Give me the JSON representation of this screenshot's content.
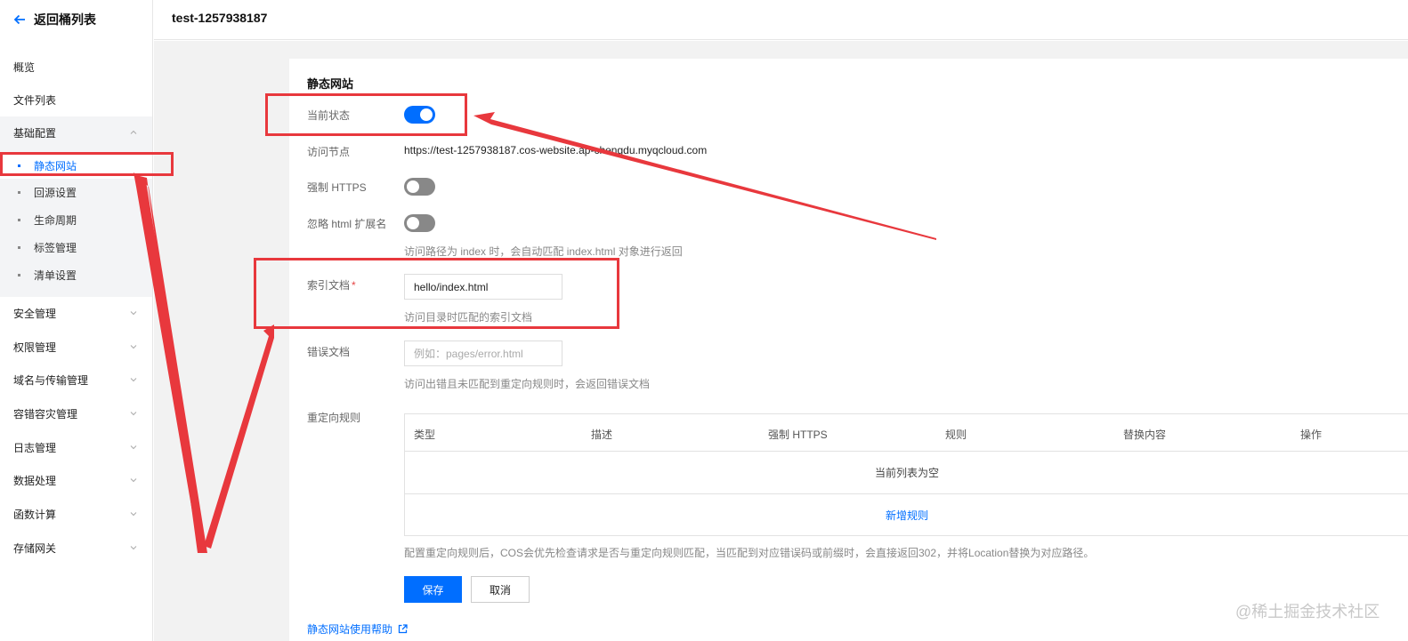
{
  "sidebar": {
    "back_label": "返回桶列表",
    "items_top": [
      "概览",
      "文件列表"
    ],
    "group": {
      "label": "基础配置",
      "children": [
        "静态网站",
        "回源设置",
        "生命周期",
        "标签管理",
        "清单设置"
      ],
      "active": "静态网站"
    },
    "items_bottom": [
      "安全管理",
      "权限管理",
      "域名与传输管理",
      "容错容灾管理",
      "日志管理",
      "数据处理",
      "函数计算",
      "存储网关"
    ]
  },
  "header": {
    "bucket_name": "test-1257938187"
  },
  "panel": {
    "title": "静态网站",
    "status_label": "当前状态",
    "status_on": true,
    "endpoint_label": "访问节点",
    "endpoint_value": "https://test-1257938187.cos-website.ap-chengdu.myqcloud.com",
    "https_label": "强制 HTTPS",
    "https_on": false,
    "ignore_ext_label": "忽略 html 扩展名",
    "ignore_ext_on": false,
    "ignore_ext_hint": "访问路径为 index 时，会自动匹配 index.html 对象进行返回",
    "index_label": "索引文档",
    "index_required_mark": "*",
    "index_value": "hello/index.html",
    "index_hint": "访问目录时匹配的索引文档",
    "error_label": "错误文档",
    "error_placeholder": "例如：pages/error.html",
    "error_hint": "访问出错且未匹配到重定向规则时，会返回错误文档",
    "redirect_label": "重定向规则",
    "table": {
      "columns": [
        "类型",
        "描述",
        "强制 HTTPS",
        "规则",
        "替换内容",
        "操作"
      ],
      "empty_text": "当前列表为空",
      "add_link": "新增规则"
    },
    "redirect_note": "配置重定向规则后，COS会优先检查请求是否与重定向规则匹配，当匹配到对应错误码或前缀时，会直接返回302，并将Location替换为对应路径。",
    "save_label": "保存",
    "cancel_label": "取消",
    "help_link": "静态网站使用帮助"
  },
  "annotation_color": "#e8383d",
  "accent_color": "#006eff",
  "watermark": "@稀土掘金技术社区"
}
